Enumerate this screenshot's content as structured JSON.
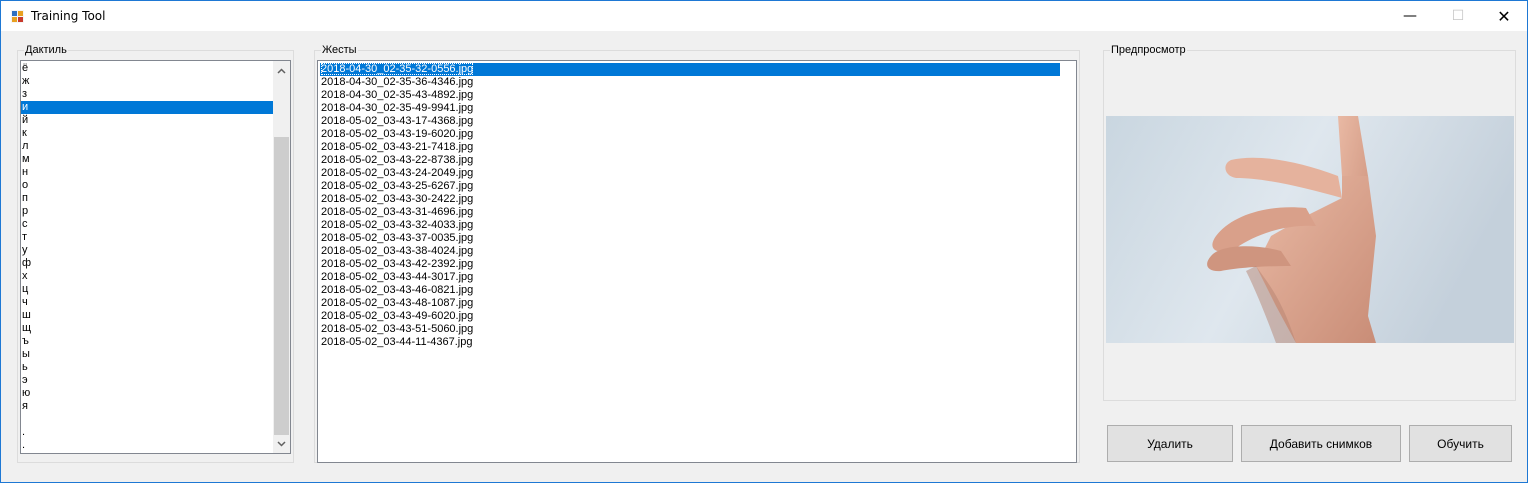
{
  "window": {
    "title": "Training Tool",
    "controls": {
      "minimize": "—",
      "maximize": "☐",
      "close": "✕"
    }
  },
  "dactyl": {
    "label": "Дактиль",
    "items": [
      "ё",
      "ж",
      "з",
      "и",
      "й",
      "к",
      "л",
      "м",
      "н",
      "о",
      "п",
      "р",
      "с",
      "т",
      "у",
      "ф",
      "х",
      "ц",
      "ч",
      "ш",
      "щ",
      "ъ",
      "ы",
      "ь",
      "э",
      "ю",
      "я",
      "",
      ".",
      "."
    ],
    "selected_index": 3
  },
  "gestures": {
    "label": "Жесты",
    "files": [
      "2018-04-30_02-35-32-0556.jpg",
      "2018-04-30_02-35-36-4346.jpg",
      "2018-04-30_02-35-43-4892.jpg",
      "2018-04-30_02-35-49-9941.jpg",
      "2018-05-02_03-43-17-4368.jpg",
      "2018-05-02_03-43-19-6020.jpg",
      "2018-05-02_03-43-21-7418.jpg",
      "2018-05-02_03-43-22-8738.jpg",
      "2018-05-02_03-43-24-2049.jpg",
      "2018-05-02_03-43-25-6267.jpg",
      "2018-05-02_03-43-30-2422.jpg",
      "2018-05-02_03-43-31-4696.jpg",
      "2018-05-02_03-43-32-4033.jpg",
      "2018-05-02_03-43-37-0035.jpg",
      "2018-05-02_03-43-38-4024.jpg",
      "2018-05-02_03-43-42-2392.jpg",
      "2018-05-02_03-43-44-3017.jpg",
      "2018-05-02_03-43-46-0821.jpg",
      "2018-05-02_03-43-48-1087.jpg",
      "2018-05-02_03-43-49-6020.jpg",
      "2018-05-02_03-43-51-5060.jpg",
      "2018-05-02_03-44-11-4367.jpg"
    ],
    "selected_index": 0
  },
  "preview": {
    "label": "Предпросмотр"
  },
  "buttons": {
    "delete": "Удалить",
    "add_images": "Добавить снимков",
    "train": "Обучить"
  },
  "colors": {
    "selection": "#0078d7",
    "window_border": "#1e78d4",
    "background": "#f0f0f0"
  }
}
